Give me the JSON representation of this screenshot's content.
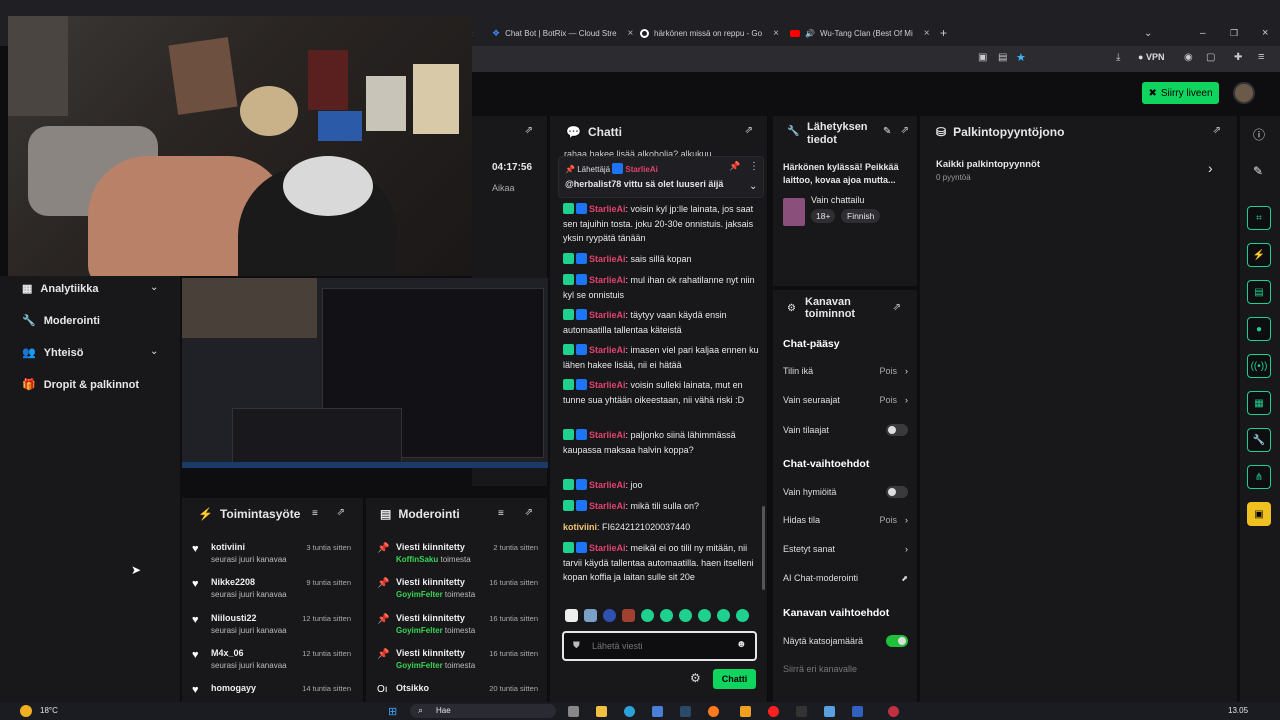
{
  "browser": {
    "tabs": [
      {
        "label": "Chat Bot | BotRix — Cloud Stre",
        "icon_color": "#3a86ff"
      },
      {
        "label": "härkönen missä on reppu - Go",
        "icon_color": "#ffffff"
      },
      {
        "label": "Wu-Tang Clan (Best Of Mi",
        "icon_color": "#ff0000"
      }
    ],
    "vpn_label": "VPN"
  },
  "header": {
    "go_live_label": "Siirry liveen"
  },
  "stream_time": "04:17:56",
  "stream_time_label": "Aikaa",
  "sidebar": {
    "items": [
      {
        "label": "Analytiikka",
        "icon": "analytics-icon",
        "expandable": true
      },
      {
        "label": "Moderointi",
        "icon": "wrench-icon",
        "expandable": false
      },
      {
        "label": "Yhteisö",
        "icon": "people-icon",
        "expandable": true
      },
      {
        "label": "Dropit & palkinnot",
        "icon": "gift-icon",
        "expandable": false
      }
    ]
  },
  "activity": {
    "title": "Toimintasyöte",
    "rows": [
      {
        "name": "kotiviini",
        "sub": "seurasi juuri kanavaa",
        "time": "3 tuntia sitten"
      },
      {
        "name": "Nikke2208",
        "sub": "seurasi juuri kanavaa",
        "time": "9 tuntia sitten"
      },
      {
        "name": "Niilousti22",
        "sub": "seurasi juuri kanavaa",
        "time": "12 tuntia sitten"
      },
      {
        "name": "M4x_06",
        "sub": "seurasi juuri kanavaa",
        "time": "12 tuntia sitten"
      },
      {
        "name": "homogayy",
        "sub": "",
        "time": "14 tuntia sitten"
      }
    ]
  },
  "moderation": {
    "title": "Moderointi",
    "rows": [
      {
        "name": "Viesti kiinnitetty",
        "user": "KoffinSaku",
        "suffix": "toimesta",
        "time": "2 tuntia sitten"
      },
      {
        "name": "Viesti kiinnitetty",
        "user": "GoyimFelter",
        "suffix": "toimesta",
        "time": "16 tuntia sitten"
      },
      {
        "name": "Viesti kiinnitetty",
        "user": "GoyimFelter",
        "suffix": "toimesta",
        "time": "16 tuntia sitten"
      },
      {
        "name": "Viesti kiinnitetty",
        "user": "GoyimFelter",
        "suffix": "toimesta",
        "time": "16 tuntia sitten"
      },
      {
        "name": "Otsikko",
        "user": "",
        "suffix": "",
        "time": "20 tuntia sitten"
      }
    ]
  },
  "chat": {
    "title": "Chatti",
    "top_text": "rahaa hakee lisää alkoholia? alkukuu",
    "pinned_label": "Lähettäjä",
    "pinned_user": "StarlieAi",
    "pinned_text": "@herbalist78 vittu sä olet luuseri äijä",
    "messages": [
      {
        "user": "StarlieAi",
        "text": "voisin kyl jp:lle lainata, jos saat sen tajuihin tosta. joku 20-30e onnistuis. jaksais yksin ryypätä tänään"
      },
      {
        "user": "StarlieAi",
        "text": "sais sillä kopan"
      },
      {
        "user": "StarlieAi",
        "text": "mul ihan ok rahatilanne nyt niin kyl se onnistuis"
      },
      {
        "user": "StarlieAi",
        "text": "täytyy vaan käydä ensin automaatilla tallentaa käteistä"
      },
      {
        "user": "StarlieAi",
        "text": "imasen viel pari kaljaa ennen ku lähen hakee lisää, nii ei hätää"
      },
      {
        "user": "StarlieAi",
        "text": "voisin sulleki lainata, mut en tunne sua yhtään oikeestaan, nii vähä riski :D"
      },
      {
        "user": "StarlieAi",
        "text": "paljonko siinä lähimmässä kaupassa maksaa halvin koppa?"
      },
      {
        "user": "StarlieAi",
        "text": "joo"
      },
      {
        "user": "StarlieAi",
        "text": "mikä tili sulla on?"
      },
      {
        "user": "kotiviini",
        "text": "FI6242121020037440"
      },
      {
        "user": "StarlieAi",
        "text": "meikäl ei oo tilil ny mitään, nii tarvii käydä tallentaa automaatilla. haen itselleni kopan koffia ja laitan sulle sit 20e"
      }
    ],
    "input_placeholder": "Lähetä viesti",
    "send_label": "Chatti"
  },
  "stream_info": {
    "title": "Lähetyksen tiedot",
    "stream_title": "Härkönen kylässä! Peikkää laittoo, kovaa ajoa mutta...",
    "category": "Vain chattailu",
    "tags": [
      "18+",
      "Finnish"
    ]
  },
  "channel_actions": {
    "title": "Kanavan toiminnot",
    "chat_access_title": "Chat-pääsy",
    "chat_access": [
      {
        "label": "Tilin ikä",
        "value": "Pois",
        "control": "arrow"
      },
      {
        "label": "Vain seuraajat",
        "value": "Pois",
        "control": "arrow"
      },
      {
        "label": "Vain tilaajat",
        "value": "",
        "control": "toggle-off"
      }
    ],
    "chat_options_title": "Chat-vaihtoehdot",
    "chat_options": [
      {
        "label": "Vain hymiöitä",
        "value": "",
        "control": "toggle-off"
      },
      {
        "label": "Hidas tila",
        "value": "Pois",
        "control": "arrow"
      },
      {
        "label": "Estetyt sanat",
        "value": "",
        "control": "arrow"
      },
      {
        "label": "AI Chat-moderointi",
        "value": "",
        "control": "external"
      }
    ],
    "channel_options_title": "Kanavan vaihtoehdot",
    "channel_options": [
      {
        "label": "Näytä katsojamäärä",
        "value": "",
        "control": "toggle-on"
      },
      {
        "label": "Siirrä eri kanavalle",
        "value": "",
        "control": "none"
      }
    ]
  },
  "rewards": {
    "title": "Palkintopyyntöjono",
    "all_label": "Kaikki palkintopyynnöt",
    "count_label": "0 pyyntöä"
  },
  "taskbar": {
    "weather": "18°C",
    "search_placeholder": "Hae",
    "clock": "13.05"
  },
  "colors": {
    "accent": "#1fd18f",
    "go_live": "#0fd45e",
    "username": "#e0436d"
  }
}
